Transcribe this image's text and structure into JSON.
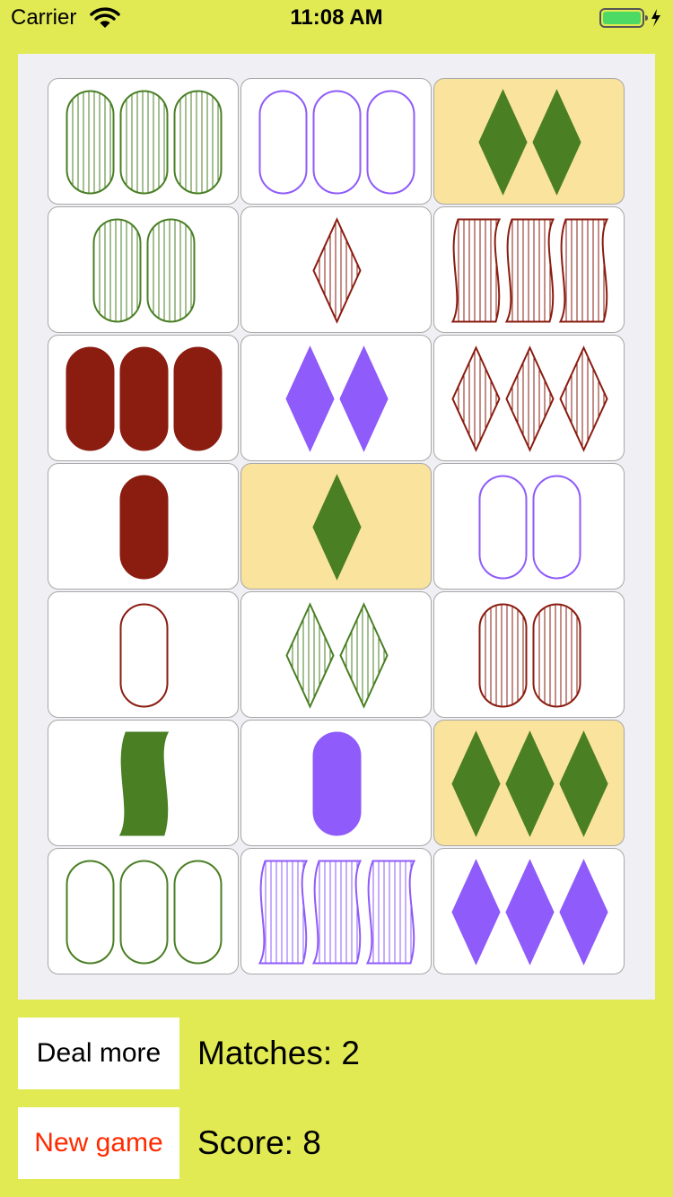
{
  "status_bar": {
    "carrier": "Carrier",
    "time": "11:08 AM",
    "wifi_icon": "wifi-icon",
    "battery_icon": "battery-icon",
    "battery_color": "#4cd964"
  },
  "colors": {
    "background": "#e1ea53",
    "board": "#efeff4",
    "card": "#ffffff",
    "selected_card": "#fae39c",
    "green": "#4a7f24",
    "purple": "#8f5bfa",
    "red": "#8a1c10",
    "new_game_text": "#ff2a00"
  },
  "cards": [
    {
      "count": 3,
      "shape": "oval",
      "color": "green",
      "shading": "striped",
      "selected": false
    },
    {
      "count": 3,
      "shape": "oval",
      "color": "purple",
      "shading": "open",
      "selected": false
    },
    {
      "count": 2,
      "shape": "diamond",
      "color": "green",
      "shading": "solid",
      "selected": true
    },
    {
      "count": 2,
      "shape": "oval",
      "color": "green",
      "shading": "striped",
      "selected": false
    },
    {
      "count": 1,
      "shape": "diamond",
      "color": "red",
      "shading": "striped",
      "selected": false
    },
    {
      "count": 3,
      "shape": "squiggle",
      "color": "red",
      "shading": "striped",
      "selected": false
    },
    {
      "count": 3,
      "shape": "oval",
      "color": "red",
      "shading": "solid",
      "selected": false
    },
    {
      "count": 2,
      "shape": "diamond",
      "color": "purple",
      "shading": "solid",
      "selected": false
    },
    {
      "count": 3,
      "shape": "diamond",
      "color": "red",
      "shading": "striped",
      "selected": false
    },
    {
      "count": 1,
      "shape": "oval",
      "color": "red",
      "shading": "solid",
      "selected": false
    },
    {
      "count": 1,
      "shape": "diamond",
      "color": "green",
      "shading": "solid",
      "selected": true
    },
    {
      "count": 2,
      "shape": "oval",
      "color": "purple",
      "shading": "open",
      "selected": false
    },
    {
      "count": 1,
      "shape": "oval",
      "color": "red",
      "shading": "open",
      "selected": false
    },
    {
      "count": 2,
      "shape": "diamond",
      "color": "green",
      "shading": "striped",
      "selected": false
    },
    {
      "count": 2,
      "shape": "oval",
      "color": "red",
      "shading": "striped",
      "selected": false
    },
    {
      "count": 1,
      "shape": "squiggle",
      "color": "green",
      "shading": "solid",
      "selected": false
    },
    {
      "count": 1,
      "shape": "oval",
      "color": "purple",
      "shading": "solid",
      "selected": false
    },
    {
      "count": 3,
      "shape": "diamond",
      "color": "green",
      "shading": "solid",
      "selected": true
    },
    {
      "count": 3,
      "shape": "oval",
      "color": "green",
      "shading": "open",
      "selected": false
    },
    {
      "count": 3,
      "shape": "squiggle",
      "color": "purple",
      "shading": "striped",
      "selected": false
    },
    {
      "count": 3,
      "shape": "diamond",
      "color": "purple",
      "shading": "solid",
      "selected": false
    }
  ],
  "controls": {
    "deal_more_label": "Deal more",
    "new_game_label": "New game",
    "matches_text": "Matches: 2",
    "score_text": "Score: 8"
  }
}
